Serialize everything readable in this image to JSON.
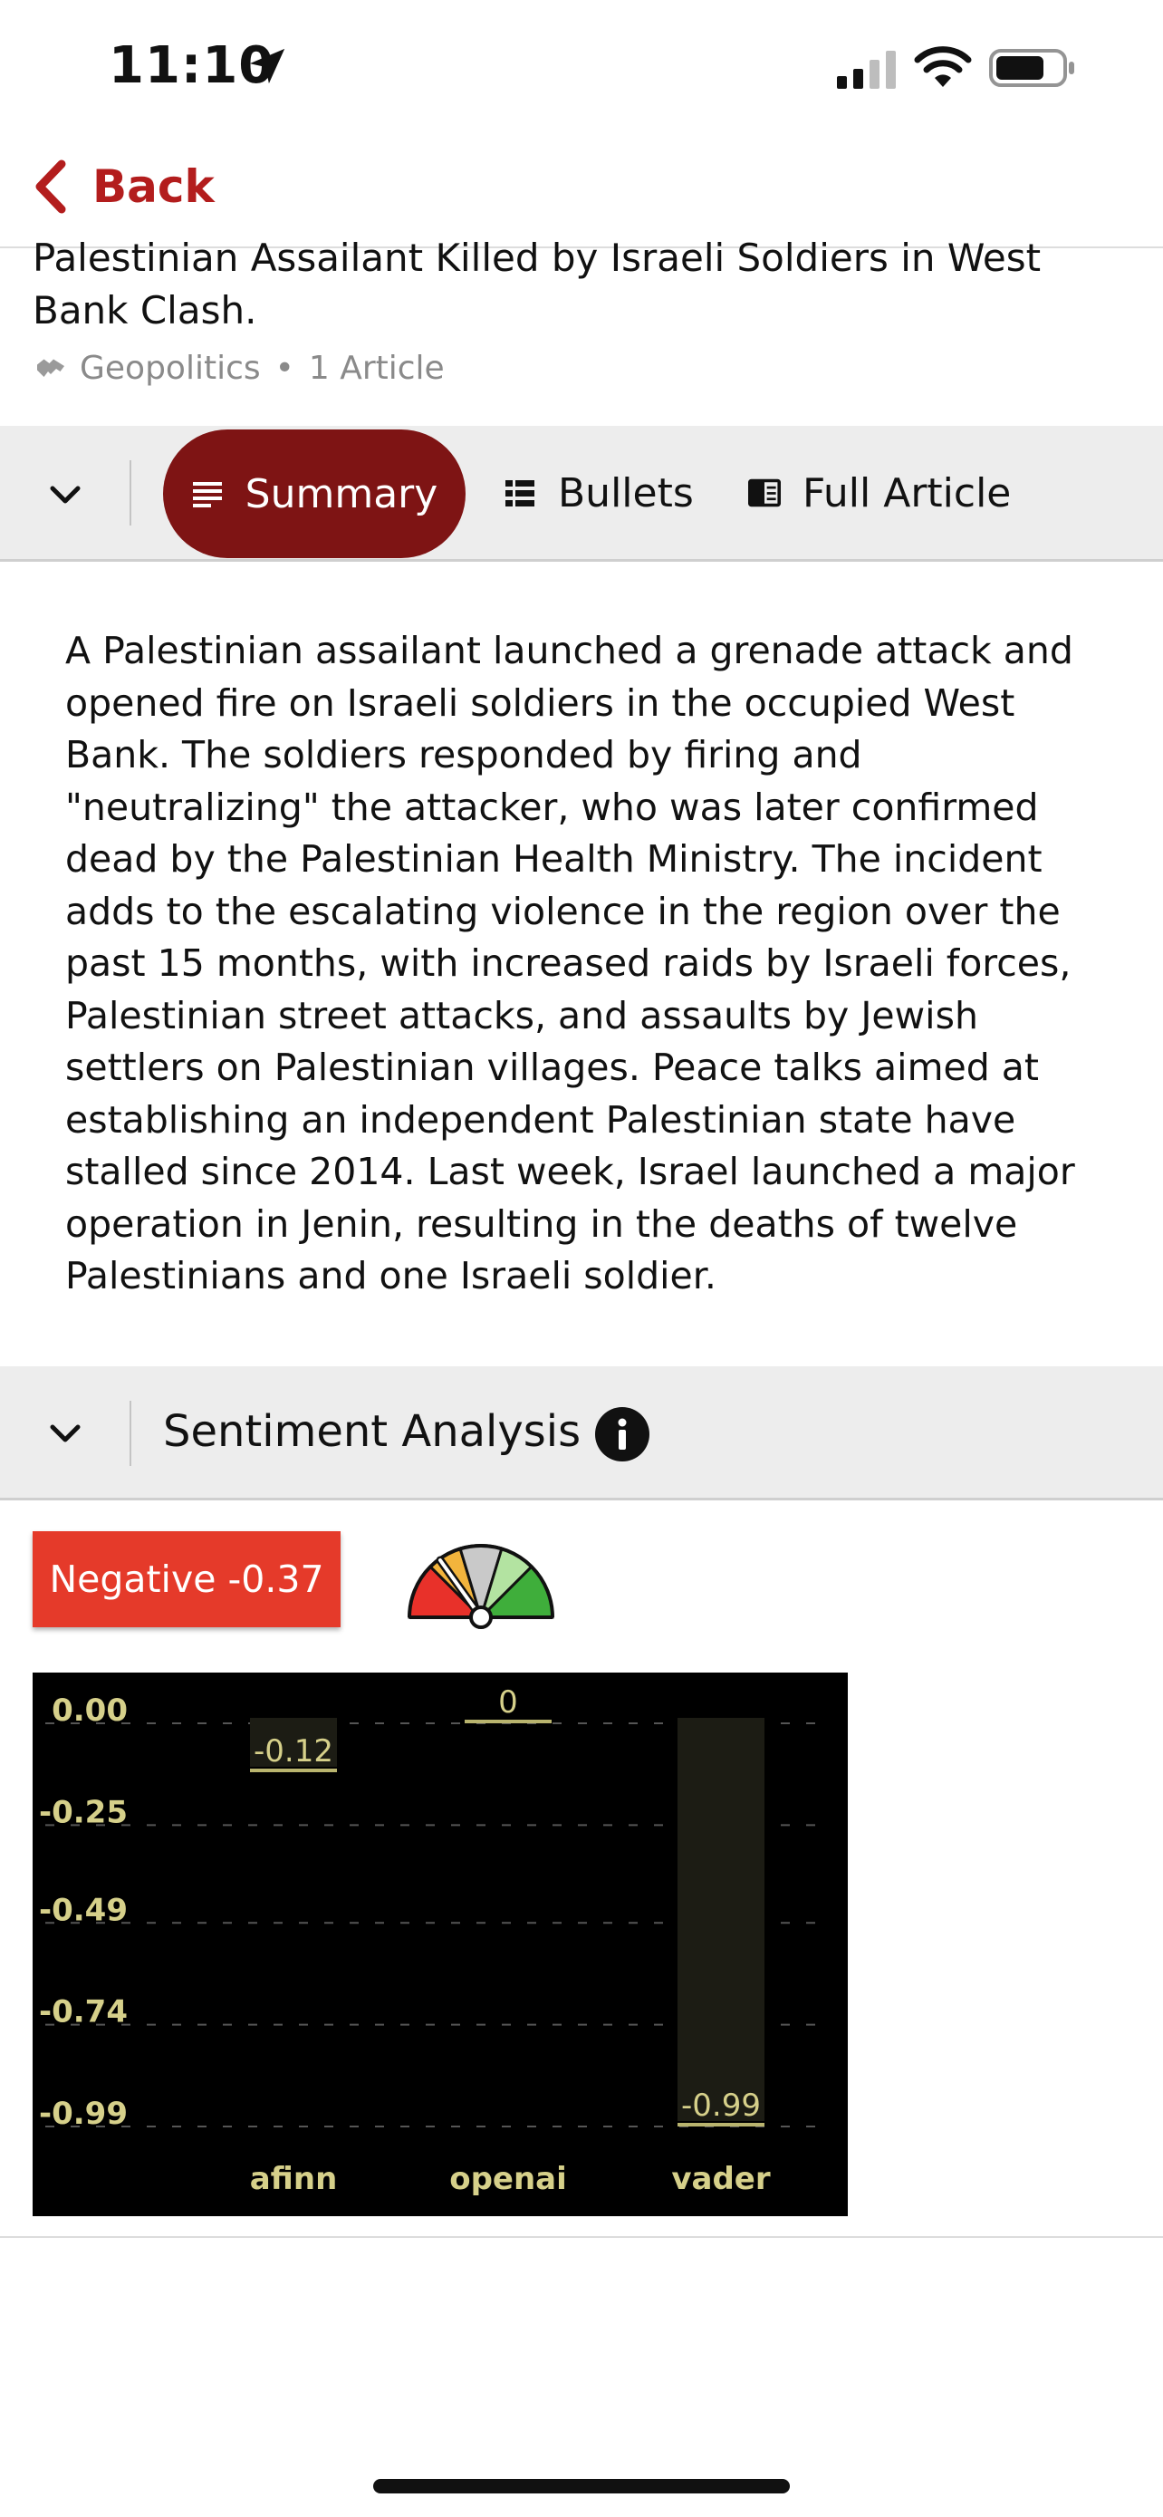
{
  "status_bar": {
    "time": "11:10"
  },
  "nav": {
    "back_label": "Back"
  },
  "article": {
    "title": "Palestinian Assailant Killed by Israeli Soldiers in West Bank Clash.",
    "category": "Geopolitics",
    "article_count": "1 Article"
  },
  "tabs": [
    {
      "label": "Summary",
      "icon": "summary-lines-icon",
      "active": true
    },
    {
      "label": "Bullets",
      "icon": "bullet-list-icon",
      "active": false
    },
    {
      "label": "Full Article",
      "icon": "article-book-icon",
      "active": false
    }
  ],
  "summary": "A Palestinian assailant launched a grenade attack and opened fire on Israeli soldiers in the occupied West Bank. The soldiers responded by firing and \"neutralizing\" the attacker, who was later confirmed dead by the Palestinian Health Ministry. The incident adds to the escalating violence in the region over the past 15 months, with increased raids by Israeli forces, Palestinian street attacks, and assaults by Jewish settlers on Palestinian villages. Peace talks aimed at establishing an independent Palestinian state have stalled since 2014. Last week, Israel launched a major operation in Jenin, resulting in the deaths of twelve Palestinians and one Israeli soldier.",
  "sentiment": {
    "title": "Sentiment Analysis",
    "badge": "Negative -0.37",
    "score": -0.37,
    "colors": {
      "badge": "#e53a2a",
      "accent": "#7e1414"
    }
  },
  "chart_data": {
    "type": "bar",
    "categories": [
      "afinn",
      "openai",
      "vader"
    ],
    "values": [
      -0.12,
      0,
      -0.99
    ],
    "value_labels": [
      "-0.12",
      "0",
      "-0.99"
    ],
    "y_ticks": [
      "0.00",
      "-0.25",
      "-0.49",
      "-0.74",
      "-0.99"
    ],
    "ylim": [
      -0.99,
      0
    ],
    "grid": true,
    "colors": {
      "background": "#000000",
      "text": "#d6d08a",
      "bar": "#1c1c14",
      "label_line": "#b9b46e"
    }
  }
}
